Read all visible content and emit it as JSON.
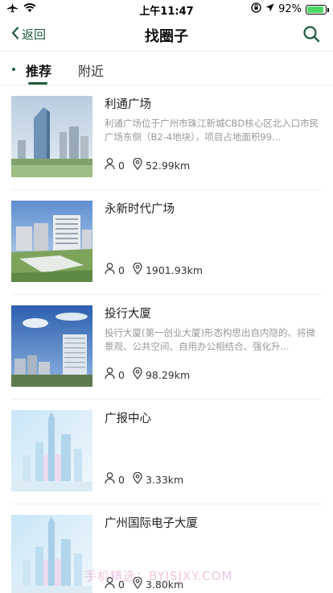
{
  "status_bar": {
    "time": "上午11:47",
    "battery_percent": "92%",
    "battery_level": 0.92,
    "battery_color": "#4cd964"
  },
  "nav": {
    "back_label": "返回",
    "title": "找圈子",
    "accent_color": "#1e5c3a",
    "icons": {
      "back": "chevron-left-icon",
      "search": "search-icon"
    }
  },
  "tabs": [
    {
      "label": "推荐",
      "active": true
    },
    {
      "label": "附近",
      "active": false
    }
  ],
  "items": [
    {
      "title": "利通广场",
      "description": "利通广场位于广州市珠江新城CBD核心区北入口市民广场东侧（B2-4地块），项目占地面积99...",
      "members": "0",
      "distance": "52.99km"
    },
    {
      "title": "永新时代广场",
      "description": "",
      "members": "0",
      "distance": "1901.93km"
    },
    {
      "title": "投行大厦",
      "description": "投行大厦(第一创业大厦)形态构思出自内隐的、将微景观、公共空间、自用办公相结合、强化升...",
      "members": "0",
      "distance": "98.29km"
    },
    {
      "title": "广报中心",
      "description": "",
      "members": "0",
      "distance": "3.33km"
    },
    {
      "title": "广州国际电子大厦",
      "description": "",
      "members": "0",
      "distance": "3.80km"
    }
  ],
  "watermark": "手机精选：BYJSJXY.COM"
}
